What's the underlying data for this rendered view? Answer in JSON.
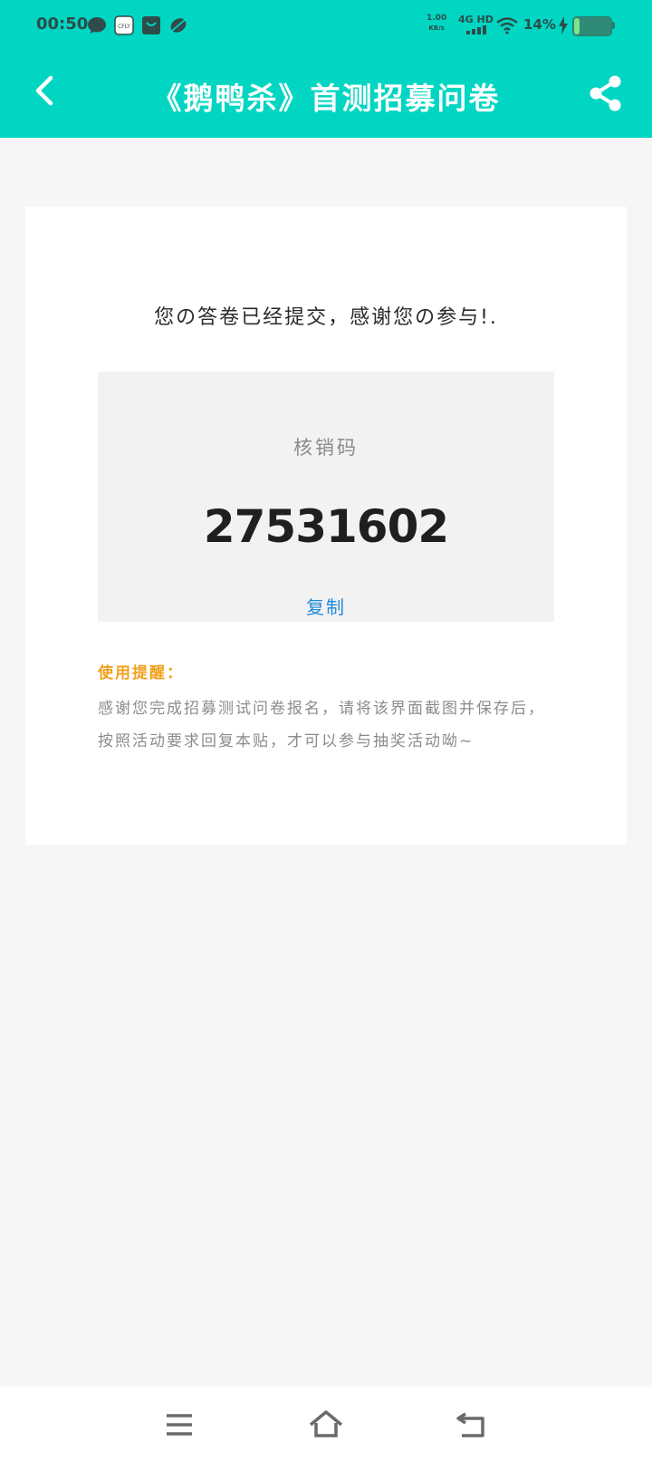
{
  "status_bar": {
    "time": "00:50",
    "net_speed": "1.00",
    "net_unit": "KB/s",
    "network_type": "4G HD",
    "battery_percent": "14%",
    "battery_level": 0.14,
    "notification_icons": [
      "chat-bubble-icon",
      "app-badge-icon",
      "shopping-bag-icon",
      "leaf-icon"
    ]
  },
  "header": {
    "title": "《鹅鸭杀》首测招募问卷",
    "back_icon": "chevron-left-icon",
    "share_icon": "share-icon",
    "background_color": "#00d6c2"
  },
  "main": {
    "message": "您の答卷已经提交，感谢您の参与!.",
    "code_label": "核销码",
    "code_value": "27531602",
    "copy_label": "复制",
    "tip_title": "使用提醒：",
    "tip_lines": [
      "感谢您完成招募测试问卷报名，请将该界面截图并保存后，",
      "按照活动要求回复本贴，才可以参与抽奖活动呦~"
    ],
    "accent_color": "#f0a11b",
    "link_color": "#1f8ad8"
  },
  "system_nav": {
    "buttons": [
      "menu-icon",
      "home-icon",
      "back-icon"
    ]
  }
}
